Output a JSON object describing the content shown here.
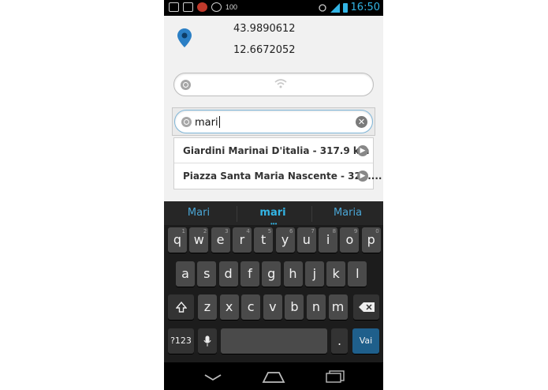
{
  "status_bar": {
    "left_text": "100",
    "time": "16:50",
    "accent_color": "#33b5e5"
  },
  "location": {
    "icon": "map-pin-icon",
    "latitude": "43.9890612",
    "longitude": "12.6672052"
  },
  "search": {
    "query": "mari",
    "clear_icon": "✕"
  },
  "suggestions": [
    {
      "text": "Giardini Marinai D'italia - 317.9 km"
    },
    {
      "text": "Piazza Santa Maria Nascente - 324...."
    }
  ],
  "keyboard": {
    "predictions": [
      "Mari",
      "mari",
      "Maria"
    ],
    "row1": [
      {
        "k": "q",
        "h": "1"
      },
      {
        "k": "w",
        "h": "2"
      },
      {
        "k": "e",
        "h": "3"
      },
      {
        "k": "r",
        "h": "4"
      },
      {
        "k": "t",
        "h": "5"
      },
      {
        "k": "y",
        "h": "6"
      },
      {
        "k": "u",
        "h": "7"
      },
      {
        "k": "i",
        "h": "8"
      },
      {
        "k": "o",
        "h": "9"
      },
      {
        "k": "p",
        "h": "0"
      }
    ],
    "row2": [
      "a",
      "s",
      "d",
      "f",
      "g",
      "h",
      "j",
      "k",
      "l"
    ],
    "row3": [
      "z",
      "x",
      "c",
      "v",
      "b",
      "n",
      "m"
    ],
    "symbols_label": "?123",
    "period_label": ".",
    "enter_label": "Vai"
  }
}
